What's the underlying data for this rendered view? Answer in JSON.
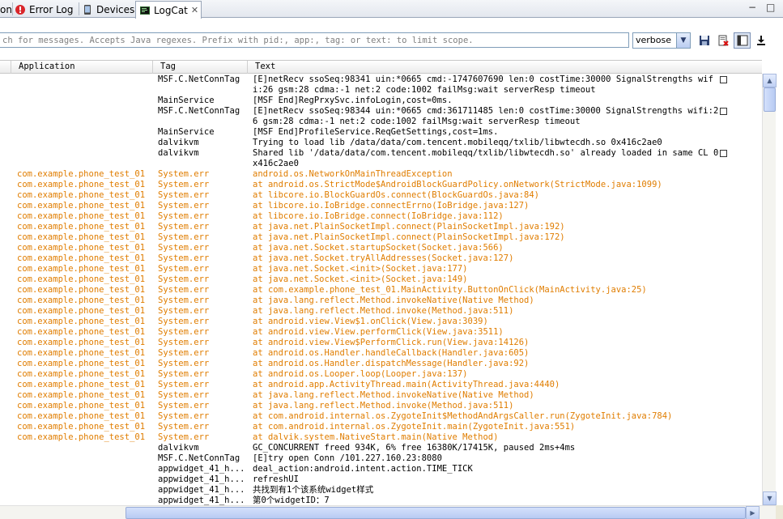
{
  "tabs": [
    {
      "label": "on",
      "icon": "console-icon",
      "closable": false,
      "active": false
    },
    {
      "label": "Error Log",
      "icon": "error-log-icon",
      "closable": false,
      "active": false
    },
    {
      "label": "Devices",
      "icon": "devices-icon",
      "closable": false,
      "active": false
    },
    {
      "label": "LogCat",
      "icon": "logcat-icon",
      "closable": true,
      "active": true
    }
  ],
  "window_controls": {
    "minimize": "−",
    "maximize": "□",
    "close_glyph": "✕"
  },
  "filter": {
    "placeholder": "ch for messages. Accepts Java regexes. Prefix with pid:, app:, tag: or text: to limit scope.",
    "value": ""
  },
  "log_level": {
    "selected": "verbose"
  },
  "toolbar": {
    "icons": [
      "save-icon",
      "clear-log-icon",
      "toggle-filters-icon",
      "scroll-lock-icon"
    ]
  },
  "table": {
    "headers": {
      "application": "Application",
      "tag": "Tag",
      "text": "Text"
    },
    "rows": [
      {
        "app": "",
        "tag": "MSF.C.NetConnTag",
        "text": "[E]netRecv ssoSeq:98341 uin:*0665 cmd:-1747607690 len:0 costTime:30000 SignalStrengths wifi:26 gsm:28 cdma:-1 net:2 code:1002 failMsg:wait serverResp timeout",
        "level": "info",
        "wrap": true
      },
      {
        "app": "",
        "tag": "MainService",
        "text": "[MSF End]RegPrxySvc.infoLogin,cost=0ms.",
        "level": "info",
        "wrap": false
      },
      {
        "app": "",
        "tag": "MSF.C.NetConnTag",
        "text": "[E]netRecv ssoSeq:98344 uin:*0665 cmd:361711485 len:0 costTime:30000 SignalStrengths wifi:26 gsm:28 cdma:-1 net:2 code:1002 failMsg:wait serverResp timeout",
        "level": "info",
        "wrap": true
      },
      {
        "app": "",
        "tag": "MainService",
        "text": "[MSF End]ProfileService.ReqGetSettings,cost=1ms.",
        "level": "info",
        "wrap": false
      },
      {
        "app": "",
        "tag": "dalvikvm",
        "text": "Trying to load lib /data/data/com.tencent.mobileqq/txlib/libwtecdh.so 0x416c2ae0",
        "level": "info",
        "wrap": false
      },
      {
        "app": "",
        "tag": "dalvikvm",
        "text": "Shared lib '/data/data/com.tencent.mobileqq/txlib/libwtecdh.so' already loaded in same CL 0x416c2ae0",
        "level": "info",
        "wrap": true
      },
      {
        "app": "com.example.phone_test_01",
        "tag": "System.err",
        "text": "android.os.NetworkOnMainThreadException",
        "level": "err",
        "wrap": false
      },
      {
        "app": "com.example.phone_test_01",
        "tag": "System.err",
        "text": "at android.os.StrictMode$AndroidBlockGuardPolicy.onNetwork(StrictMode.java:1099)",
        "level": "err",
        "wrap": false
      },
      {
        "app": "com.example.phone_test_01",
        "tag": "System.err",
        "text": "at libcore.io.BlockGuardOs.connect(BlockGuardOs.java:84)",
        "level": "err",
        "wrap": false
      },
      {
        "app": "com.example.phone_test_01",
        "tag": "System.err",
        "text": "at libcore.io.IoBridge.connectErrno(IoBridge.java:127)",
        "level": "err",
        "wrap": false
      },
      {
        "app": "com.example.phone_test_01",
        "tag": "System.err",
        "text": "at libcore.io.IoBridge.connect(IoBridge.java:112)",
        "level": "err",
        "wrap": false
      },
      {
        "app": "com.example.phone_test_01",
        "tag": "System.err",
        "text": "at java.net.PlainSocketImpl.connect(PlainSocketImpl.java:192)",
        "level": "err",
        "wrap": false
      },
      {
        "app": "com.example.phone_test_01",
        "tag": "System.err",
        "text": "at java.net.PlainSocketImpl.connect(PlainSocketImpl.java:172)",
        "level": "err",
        "wrap": false
      },
      {
        "app": "com.example.phone_test_01",
        "tag": "System.err",
        "text": "at java.net.Socket.startupSocket(Socket.java:566)",
        "level": "err",
        "wrap": false
      },
      {
        "app": "com.example.phone_test_01",
        "tag": "System.err",
        "text": "at java.net.Socket.tryAllAddresses(Socket.java:127)",
        "level": "err",
        "wrap": false
      },
      {
        "app": "com.example.phone_test_01",
        "tag": "System.err",
        "text": "at java.net.Socket.<init>(Socket.java:177)",
        "level": "err",
        "wrap": false
      },
      {
        "app": "com.example.phone_test_01",
        "tag": "System.err",
        "text": "at java.net.Socket.<init>(Socket.java:149)",
        "level": "err",
        "wrap": false
      },
      {
        "app": "com.example.phone_test_01",
        "tag": "System.err",
        "text": "at com.example.phone_test_01.MainActivity.ButtonOnClick(MainActivity.java:25)",
        "level": "err",
        "wrap": false
      },
      {
        "app": "com.example.phone_test_01",
        "tag": "System.err",
        "text": "at java.lang.reflect.Method.invokeNative(Native Method)",
        "level": "err",
        "wrap": false
      },
      {
        "app": "com.example.phone_test_01",
        "tag": "System.err",
        "text": "at java.lang.reflect.Method.invoke(Method.java:511)",
        "level": "err",
        "wrap": false
      },
      {
        "app": "com.example.phone_test_01",
        "tag": "System.err",
        "text": "at android.view.View$1.onClick(View.java:3039)",
        "level": "err",
        "wrap": false
      },
      {
        "app": "com.example.phone_test_01",
        "tag": "System.err",
        "text": "at android.view.View.performClick(View.java:3511)",
        "level": "err",
        "wrap": false
      },
      {
        "app": "com.example.phone_test_01",
        "tag": "System.err",
        "text": "at android.view.View$PerformClick.run(View.java:14126)",
        "level": "err",
        "wrap": false
      },
      {
        "app": "com.example.phone_test_01",
        "tag": "System.err",
        "text": "at android.os.Handler.handleCallback(Handler.java:605)",
        "level": "err",
        "wrap": false
      },
      {
        "app": "com.example.phone_test_01",
        "tag": "System.err",
        "text": "at android.os.Handler.dispatchMessage(Handler.java:92)",
        "level": "err",
        "wrap": false
      },
      {
        "app": "com.example.phone_test_01",
        "tag": "System.err",
        "text": "at android.os.Looper.loop(Looper.java:137)",
        "level": "err",
        "wrap": false
      },
      {
        "app": "com.example.phone_test_01",
        "tag": "System.err",
        "text": "at android.app.ActivityThread.main(ActivityThread.java:4440)",
        "level": "err",
        "wrap": false
      },
      {
        "app": "com.example.phone_test_01",
        "tag": "System.err",
        "text": "at java.lang.reflect.Method.invokeNative(Native Method)",
        "level": "err",
        "wrap": false
      },
      {
        "app": "com.example.phone_test_01",
        "tag": "System.err",
        "text": "at java.lang.reflect.Method.invoke(Method.java:511)",
        "level": "err",
        "wrap": false
      },
      {
        "app": "com.example.phone_test_01",
        "tag": "System.err",
        "text": "at com.android.internal.os.ZygoteInit$MethodAndArgsCaller.run(ZygoteInit.java:784)",
        "level": "err",
        "wrap": false
      },
      {
        "app": "com.example.phone_test_01",
        "tag": "System.err",
        "text": "at com.android.internal.os.ZygoteInit.main(ZygoteInit.java:551)",
        "level": "err",
        "wrap": false
      },
      {
        "app": "com.example.phone_test_01",
        "tag": "System.err",
        "text": "at dalvik.system.NativeStart.main(Native Method)",
        "level": "err",
        "wrap": false
      },
      {
        "app": "",
        "tag": "dalvikvm",
        "text": "GC_CONCURRENT freed 934K, 6% free 16380K/17415K, paused 2ms+4ms",
        "level": "info",
        "wrap": false
      },
      {
        "app": "",
        "tag": "MSF.C.NetConnTag",
        "text": "[E]try open Conn /101.227.160.23:8080",
        "level": "info",
        "wrap": false
      },
      {
        "app": "",
        "tag": "appwidget_41_h...",
        "text": "deal_action:android.intent.action.TIME_TICK",
        "level": "info",
        "wrap": false
      },
      {
        "app": "",
        "tag": "appwidget_41_h...",
        "text": "refreshUI",
        "level": "info",
        "wrap": false
      },
      {
        "app": "",
        "tag": "appwidget_41_h...",
        "text": "共找到有1个该系统widget样式",
        "level": "info",
        "wrap": false
      },
      {
        "app": "",
        "tag": "appwidget_41_h...",
        "text": "第0个widgetID：7",
        "level": "info",
        "wrap": false
      }
    ]
  },
  "colors": {
    "error_text": "#e07d00",
    "info_text": "#000000",
    "accent": "#7f9db9"
  }
}
